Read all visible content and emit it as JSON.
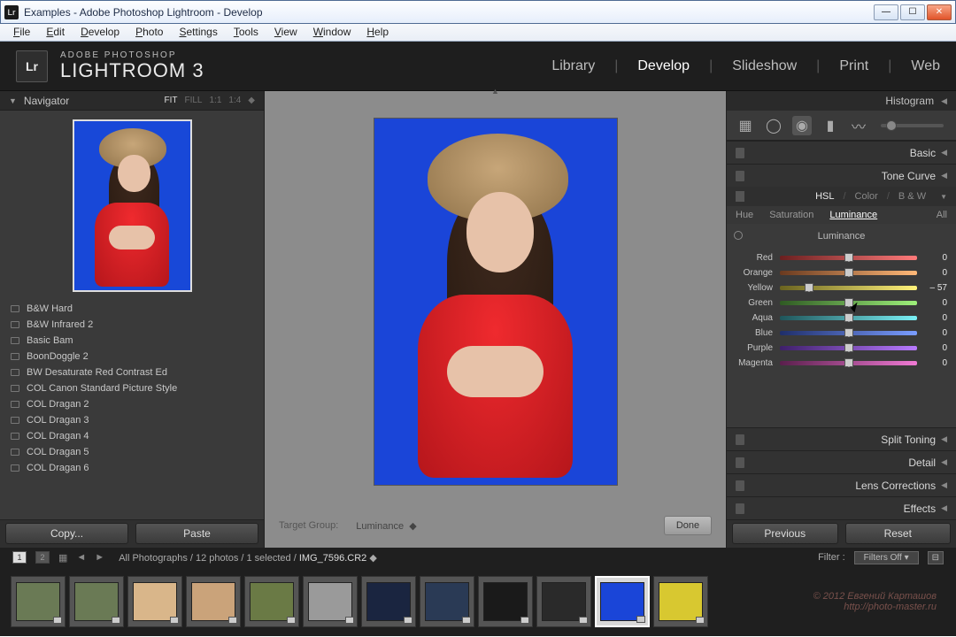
{
  "window": {
    "title": "Examples - Adobe Photoshop Lightroom - Develop"
  },
  "menu": [
    "File",
    "Edit",
    "Develop",
    "Photo",
    "Settings",
    "Tools",
    "View",
    "Window",
    "Help"
  ],
  "brand": {
    "suite": "ADOBE PHOTOSHOP",
    "app": "LIGHTROOM 3",
    "logo": "Lr"
  },
  "modules": [
    "Library",
    "Develop",
    "Slideshow",
    "Print",
    "Web"
  ],
  "active_module": "Develop",
  "navigator": {
    "title": "Navigator",
    "zoom_opts": [
      "FIT",
      "FILL",
      "1:1",
      "1:4"
    ],
    "zoom_active": "FIT"
  },
  "presets": [
    "B&W Hard",
    "B&W Infrared 2",
    "Basic Bam",
    "BoonDoggle 2",
    "BW Desaturate Red Contrast Ed",
    "COL Canon Standard Picture Style",
    "COL Dragan 2",
    "COL Dragan 3",
    "COL Dragan 4",
    "COL Dragan 5",
    "COL Dragan 6"
  ],
  "left_buttons": {
    "copy": "Copy...",
    "paste": "Paste"
  },
  "center": {
    "target_label": "Target Group:",
    "target_value": "Luminance",
    "done": "Done"
  },
  "right": {
    "histogram": "Histogram",
    "sections": [
      "Basic",
      "Tone Curve"
    ],
    "hsl_tabs": [
      "HSL",
      "Color",
      "B & W"
    ],
    "hsl_active": "HSL",
    "subtabs": [
      "Hue",
      "Saturation",
      "Luminance",
      "All"
    ],
    "subtab_active": "Luminance",
    "slider_title": "Luminance",
    "sliders": [
      {
        "label": "Red",
        "value": 0,
        "gradient": "linear-gradient(to right,#6a1f1f,#ff7a7a)"
      },
      {
        "label": "Orange",
        "value": 0,
        "gradient": "linear-gradient(to right,#6a3a1f,#ffb878)"
      },
      {
        "label": "Yellow",
        "value": -57,
        "gradient": "linear-gradient(to right,#6a631f,#fff27a)"
      },
      {
        "label": "Green",
        "value": 0,
        "gradient": "linear-gradient(to right,#2f5a23,#9ef07a)"
      },
      {
        "label": "Aqua",
        "value": 0,
        "gradient": "linear-gradient(to right,#1f555a,#7af0f5)"
      },
      {
        "label": "Blue",
        "value": 0,
        "gradient": "linear-gradient(to right,#1f2e6a,#7a9dff)"
      },
      {
        "label": "Purple",
        "value": 0,
        "gradient": "linear-gradient(to right,#3e1f6a,#b87aff)"
      },
      {
        "label": "Magenta",
        "value": 0,
        "gradient": "linear-gradient(to right,#5a1f4c,#f07ad4)"
      }
    ],
    "footer_sections": [
      "Split Toning",
      "Detail",
      "Lens Corrections",
      "Effects"
    ],
    "buttons": {
      "prev": "Previous",
      "reset": "Reset"
    }
  },
  "filmstrip": {
    "grid1": "1",
    "grid2": "2",
    "path_prefix": "All Photographs / 12 photos / 1 selected / ",
    "filename": "IMG_7596.CR2",
    "filter_label": "Filter :",
    "filter_value": "Filters Off",
    "thumbs": [
      {
        "bg": "#6a7a55"
      },
      {
        "bg": "#6a7a55"
      },
      {
        "bg": "#d9b68a"
      },
      {
        "bg": "#caa37a"
      },
      {
        "bg": "#6a7a45"
      },
      {
        "bg": "#9a9a9a"
      },
      {
        "bg": "#1a2540"
      },
      {
        "bg": "#2a3a55"
      },
      {
        "bg": "#1a1a1a"
      },
      {
        "bg": "#2a2a2a"
      },
      {
        "bg": "#1a45d8"
      },
      {
        "bg": "#d8c830"
      }
    ],
    "active_thumb": 10
  }
}
